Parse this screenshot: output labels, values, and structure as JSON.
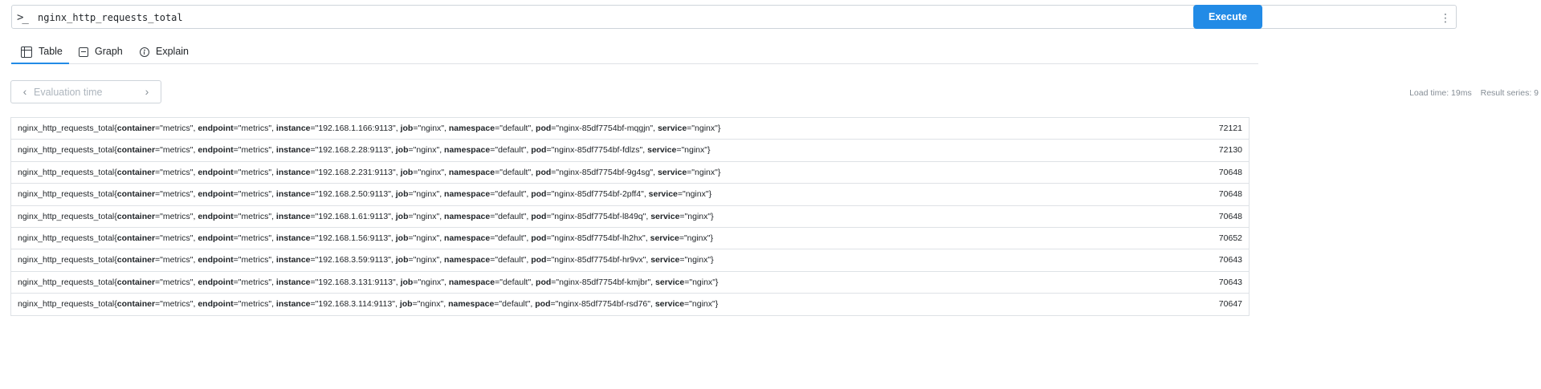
{
  "query": {
    "prompt_icon": "terminal-prompt-icon",
    "expression": "nginx_http_requests_total",
    "menu_icon": "vertical-dots-icon"
  },
  "execute_label": "Execute",
  "tabs": [
    {
      "label": "Table",
      "icon": "table-icon",
      "active": true
    },
    {
      "label": "Graph",
      "icon": "graph-icon",
      "active": false
    },
    {
      "label": "Explain",
      "icon": "info-icon",
      "active": false
    }
  ],
  "evaluation": {
    "placeholder": "Evaluation time",
    "prev_icon": "chevron-left-icon",
    "next_icon": "chevron-right-icon"
  },
  "stats": {
    "load_time": "Load time: 19ms",
    "result_series": "Result series: 9"
  },
  "colors": {
    "accent": "#228be6",
    "border": "#dee2e6",
    "muted": "#868e96"
  },
  "results": [
    {
      "metric": "nginx_http_requests_total",
      "labels": [
        [
          "container",
          "metrics"
        ],
        [
          "endpoint",
          "metrics"
        ],
        [
          "instance",
          "192.168.1.166:9113"
        ],
        [
          "job",
          "nginx"
        ],
        [
          "namespace",
          "default"
        ],
        [
          "pod",
          "nginx-85df7754bf-mqgjn"
        ],
        [
          "service",
          "nginx"
        ]
      ],
      "value": "72121"
    },
    {
      "metric": "nginx_http_requests_total",
      "labels": [
        [
          "container",
          "metrics"
        ],
        [
          "endpoint",
          "metrics"
        ],
        [
          "instance",
          "192.168.2.28:9113"
        ],
        [
          "job",
          "nginx"
        ],
        [
          "namespace",
          "default"
        ],
        [
          "pod",
          "nginx-85df7754bf-fdlzs"
        ],
        [
          "service",
          "nginx"
        ]
      ],
      "value": "72130"
    },
    {
      "metric": "nginx_http_requests_total",
      "labels": [
        [
          "container",
          "metrics"
        ],
        [
          "endpoint",
          "metrics"
        ],
        [
          "instance",
          "192.168.2.231:9113"
        ],
        [
          "job",
          "nginx"
        ],
        [
          "namespace",
          "default"
        ],
        [
          "pod",
          "nginx-85df7754bf-9g4sg"
        ],
        [
          "service",
          "nginx"
        ]
      ],
      "value": "70648"
    },
    {
      "metric": "nginx_http_requests_total",
      "labels": [
        [
          "container",
          "metrics"
        ],
        [
          "endpoint",
          "metrics"
        ],
        [
          "instance",
          "192.168.2.50:9113"
        ],
        [
          "job",
          "nginx"
        ],
        [
          "namespace",
          "default"
        ],
        [
          "pod",
          "nginx-85df7754bf-2pff4"
        ],
        [
          "service",
          "nginx"
        ]
      ],
      "value": "70648"
    },
    {
      "metric": "nginx_http_requests_total",
      "labels": [
        [
          "container",
          "metrics"
        ],
        [
          "endpoint",
          "metrics"
        ],
        [
          "instance",
          "192.168.1.61:9113"
        ],
        [
          "job",
          "nginx"
        ],
        [
          "namespace",
          "default"
        ],
        [
          "pod",
          "nginx-85df7754bf-l849q"
        ],
        [
          "service",
          "nginx"
        ]
      ],
      "value": "70648"
    },
    {
      "metric": "nginx_http_requests_total",
      "labels": [
        [
          "container",
          "metrics"
        ],
        [
          "endpoint",
          "metrics"
        ],
        [
          "instance",
          "192.168.1.56:9113"
        ],
        [
          "job",
          "nginx"
        ],
        [
          "namespace",
          "default"
        ],
        [
          "pod",
          "nginx-85df7754bf-lh2hx"
        ],
        [
          "service",
          "nginx"
        ]
      ],
      "value": "70652"
    },
    {
      "metric": "nginx_http_requests_total",
      "labels": [
        [
          "container",
          "metrics"
        ],
        [
          "endpoint",
          "metrics"
        ],
        [
          "instance",
          "192.168.3.59:9113"
        ],
        [
          "job",
          "nginx"
        ],
        [
          "namespace",
          "default"
        ],
        [
          "pod",
          "nginx-85df7754bf-hr9vx"
        ],
        [
          "service",
          "nginx"
        ]
      ],
      "value": "70643"
    },
    {
      "metric": "nginx_http_requests_total",
      "labels": [
        [
          "container",
          "metrics"
        ],
        [
          "endpoint",
          "metrics"
        ],
        [
          "instance",
          "192.168.3.131:9113"
        ],
        [
          "job",
          "nginx"
        ],
        [
          "namespace",
          "default"
        ],
        [
          "pod",
          "nginx-85df7754bf-kmjbr"
        ],
        [
          "service",
          "nginx"
        ]
      ],
      "value": "70643"
    },
    {
      "metric": "nginx_http_requests_total",
      "labels": [
        [
          "container",
          "metrics"
        ],
        [
          "endpoint",
          "metrics"
        ],
        [
          "instance",
          "192.168.3.114:9113"
        ],
        [
          "job",
          "nginx"
        ],
        [
          "namespace",
          "default"
        ],
        [
          "pod",
          "nginx-85df7754bf-rsd76"
        ],
        [
          "service",
          "nginx"
        ]
      ],
      "value": "70647"
    }
  ]
}
